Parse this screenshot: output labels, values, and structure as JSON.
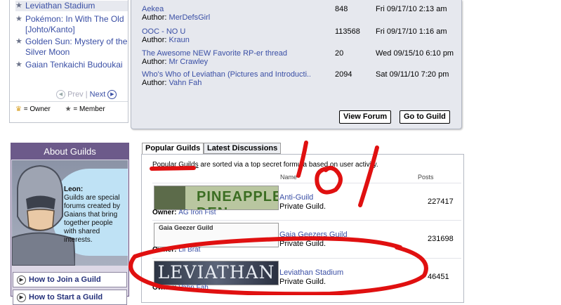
{
  "sidebar": {
    "guilds": [
      {
        "label": "Leviathan Stadium"
      },
      {
        "label": "Pokémon: In With The Old [Johto/Kanto]"
      },
      {
        "label": "Golden Sun: Mystery of the Silver Moon"
      },
      {
        "label": "Gaian Tenkaichi Budoukai"
      }
    ],
    "pager": {
      "prev": "Prev",
      "sep": "|",
      "next": "Next"
    },
    "legend": {
      "owner": "= Owner",
      "member": "= Member"
    }
  },
  "discussions": [
    {
      "title": "Aekea",
      "author_label": "Author:",
      "author": "MerDefsGirl",
      "posts": "848",
      "date": "Fri 09/17/10 2:13 am"
    },
    {
      "title": "OOC - NO U",
      "author_label": "Author:",
      "author": "Kraun",
      "posts": "113568",
      "date": "Fri 09/17/10 1:16 am"
    },
    {
      "title": "The Awesome NEW Favorite RP-er thread",
      "author_label": "Author:",
      "author": "Mr Crawley",
      "posts": "20",
      "date": "Wed 09/15/10 6:10 pm"
    },
    {
      "title": "Who's Who of Leviathan (Pictures and Introducti...",
      "author_label": "Author:",
      "author": "Vahn Fah",
      "posts": "2094",
      "date": "Sat 09/11/10 7:20 pm"
    }
  ],
  "buttons": {
    "view_forum": "View Forum",
    "goto_guild": "Go to Guild"
  },
  "about": {
    "header": "About Guilds",
    "speaker": "Leon:",
    "text": "Guilds are special forums created by Gaians that bring together people with shared interests.",
    "howto_join": "How to Join a Guild",
    "howto_start": "How to Start a Guild"
  },
  "tabs": {
    "popular": "Popular Guilds",
    "latest": "Latest Discussions"
  },
  "popular": {
    "desc_link": "Popular Guilds",
    "desc_rest": " are sorted via a top secret formula based on user activity.",
    "col_name": "Name",
    "col_posts": "Posts",
    "owner_label": "Owner:",
    "rows": [
      {
        "banner": "PINEAPPLE DEN",
        "owner": "AG Iron Fist",
        "name": "Anti-Guild",
        "type": "Private Guild.",
        "posts": "227417"
      },
      {
        "banner": "Gaia Geezer Guild",
        "owner": "Lil Brat",
        "name": "Gaia Geezers Guild",
        "type": "Private Guild.",
        "posts": "231698"
      },
      {
        "banner": "LEVIATHAN",
        "owner": "Vahn Fah",
        "name": "Leviathan Stadium",
        "type": "Private Guild.",
        "posts": "46451"
      }
    ]
  },
  "annotation": {
    "text": "lol",
    "color": "#e01010"
  }
}
